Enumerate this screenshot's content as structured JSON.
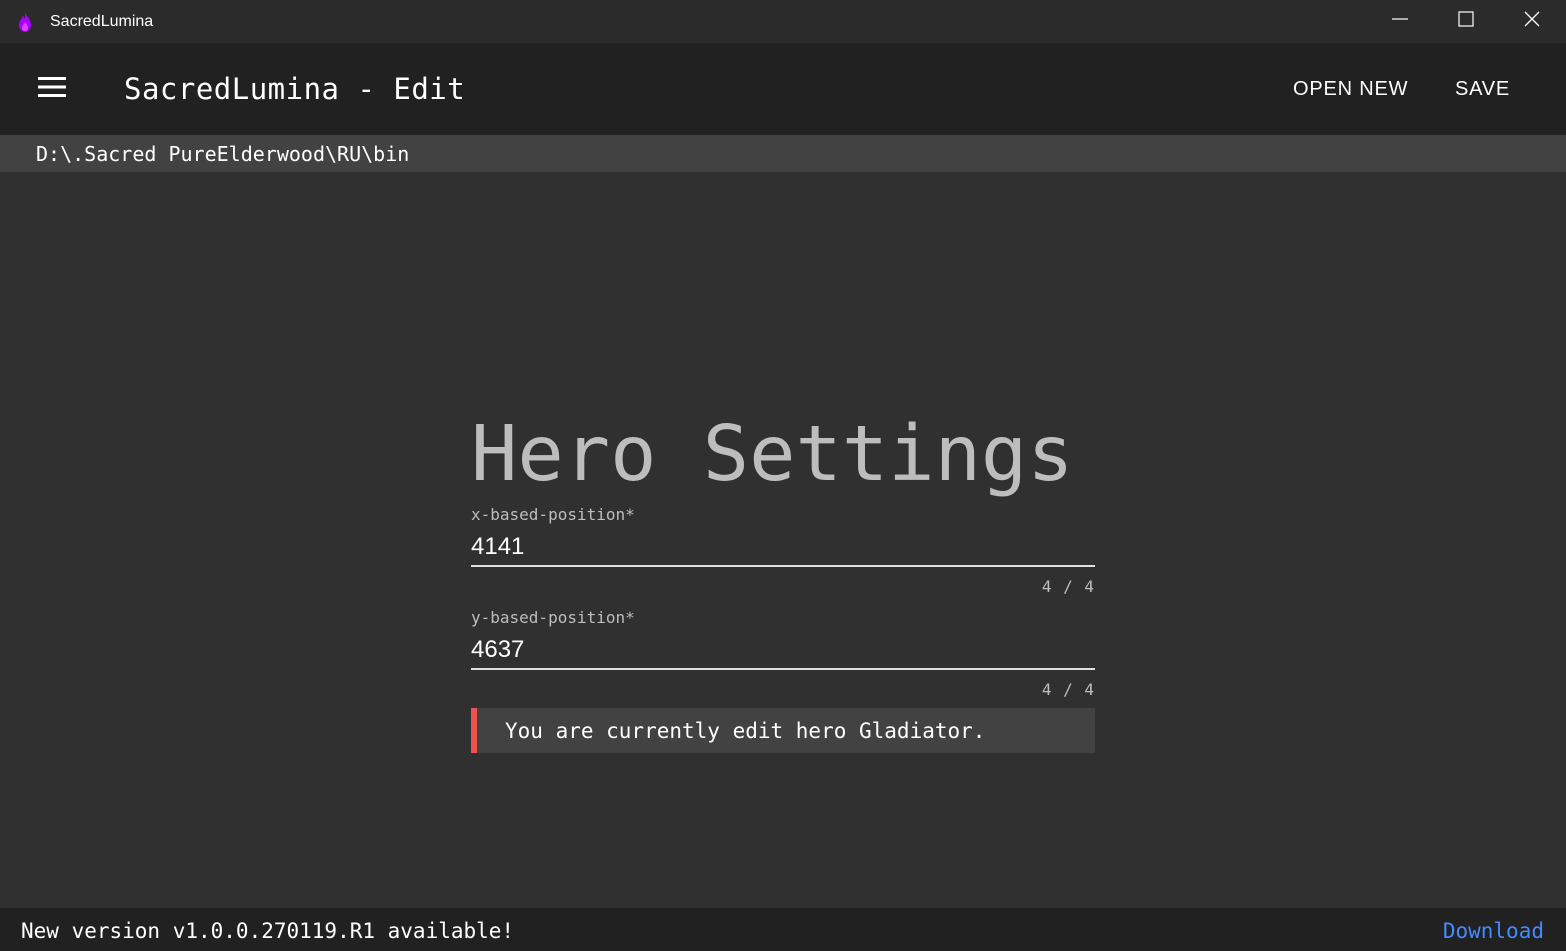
{
  "window": {
    "title": "SacredLumina",
    "icon": "flame-icon",
    "controls": [
      "minimize-icon",
      "maximize-icon",
      "close-icon"
    ]
  },
  "toolbar": {
    "menu_icon": "hamburger-menu-icon",
    "title": "SacredLumina - Edit",
    "open_new_label": "OPEN NEW",
    "save_label": "SAVE"
  },
  "path": {
    "text": "D:\\.Sacred PureElderwood\\RU\\bin"
  },
  "form": {
    "heading": "Hero Settings",
    "x_field": {
      "label": "x-based-position*",
      "value": "4141",
      "counter": "4 / 4"
    },
    "y_field": {
      "label": "y-based-position*",
      "value": "4637",
      "counter": "4 / 4"
    },
    "notice": "You are currently edit hero Gladiator."
  },
  "update": {
    "message": "New version v1.0.0.270119.R1 available!",
    "download_label": "Download"
  },
  "colors": {
    "background": "#303030",
    "toolbar": "#212121",
    "pathbar": "#424242",
    "notice_accent": "#ef5350",
    "link": "#448aff",
    "icon_flame": "#aa00ff"
  }
}
